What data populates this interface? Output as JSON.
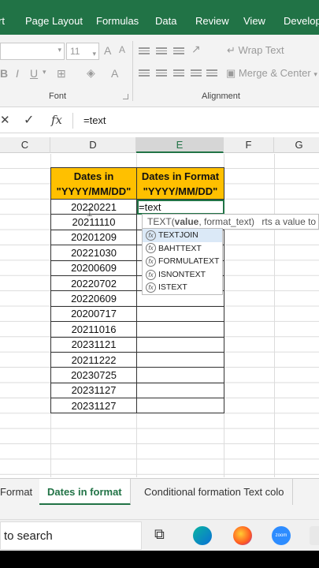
{
  "ribbon": {
    "tabs": [
      "rt",
      "Page Layout",
      "Formulas",
      "Data",
      "Review",
      "View",
      "Develop"
    ],
    "font_size": "11",
    "font_group_label": "Font",
    "alignment_group_label": "Alignment",
    "wrap_text": "Wrap Text",
    "merge_center": "Merge & Center",
    "bold": "B",
    "italic": "I",
    "underline": "U",
    "font_grow": "A",
    "font_shrink": "A",
    "font_color": "A"
  },
  "formula_bar": {
    "content": "=text",
    "fx": "fx"
  },
  "columns": [
    "C",
    "D",
    "E",
    "F",
    "G"
  ],
  "table": {
    "header_d": [
      "Dates in",
      "\"YYYY/MM/DD\""
    ],
    "header_e": [
      "Dates in Format",
      "\"YYYY/MM/DD\""
    ],
    "dates": [
      "20220221",
      "20211110",
      "20201209",
      "20221030",
      "20200609",
      "20220702",
      "20220609",
      "20200717",
      "20211016",
      "20231121",
      "20211222",
      "20230725",
      "20231127",
      "20231127"
    ],
    "active_cell_value": "=text"
  },
  "autocomplete": {
    "tooltip_func": "TEXT(",
    "tooltip_bold": "value",
    "tooltip_rest": ", format_text)",
    "tooltip_desc": "rts a value to te",
    "items": [
      "TEXTJOIN",
      "BAHTTEXT",
      "FORMULATEXT",
      "ISNONTEXT",
      "ISTEXT"
    ]
  },
  "sheets": [
    "Format",
    "Dates in format",
    "Conditional formation Text colo"
  ],
  "taskbar": {
    "search": "to search"
  },
  "colors": {
    "excel_green": "#217346",
    "header_fill": "#ffc000"
  }
}
